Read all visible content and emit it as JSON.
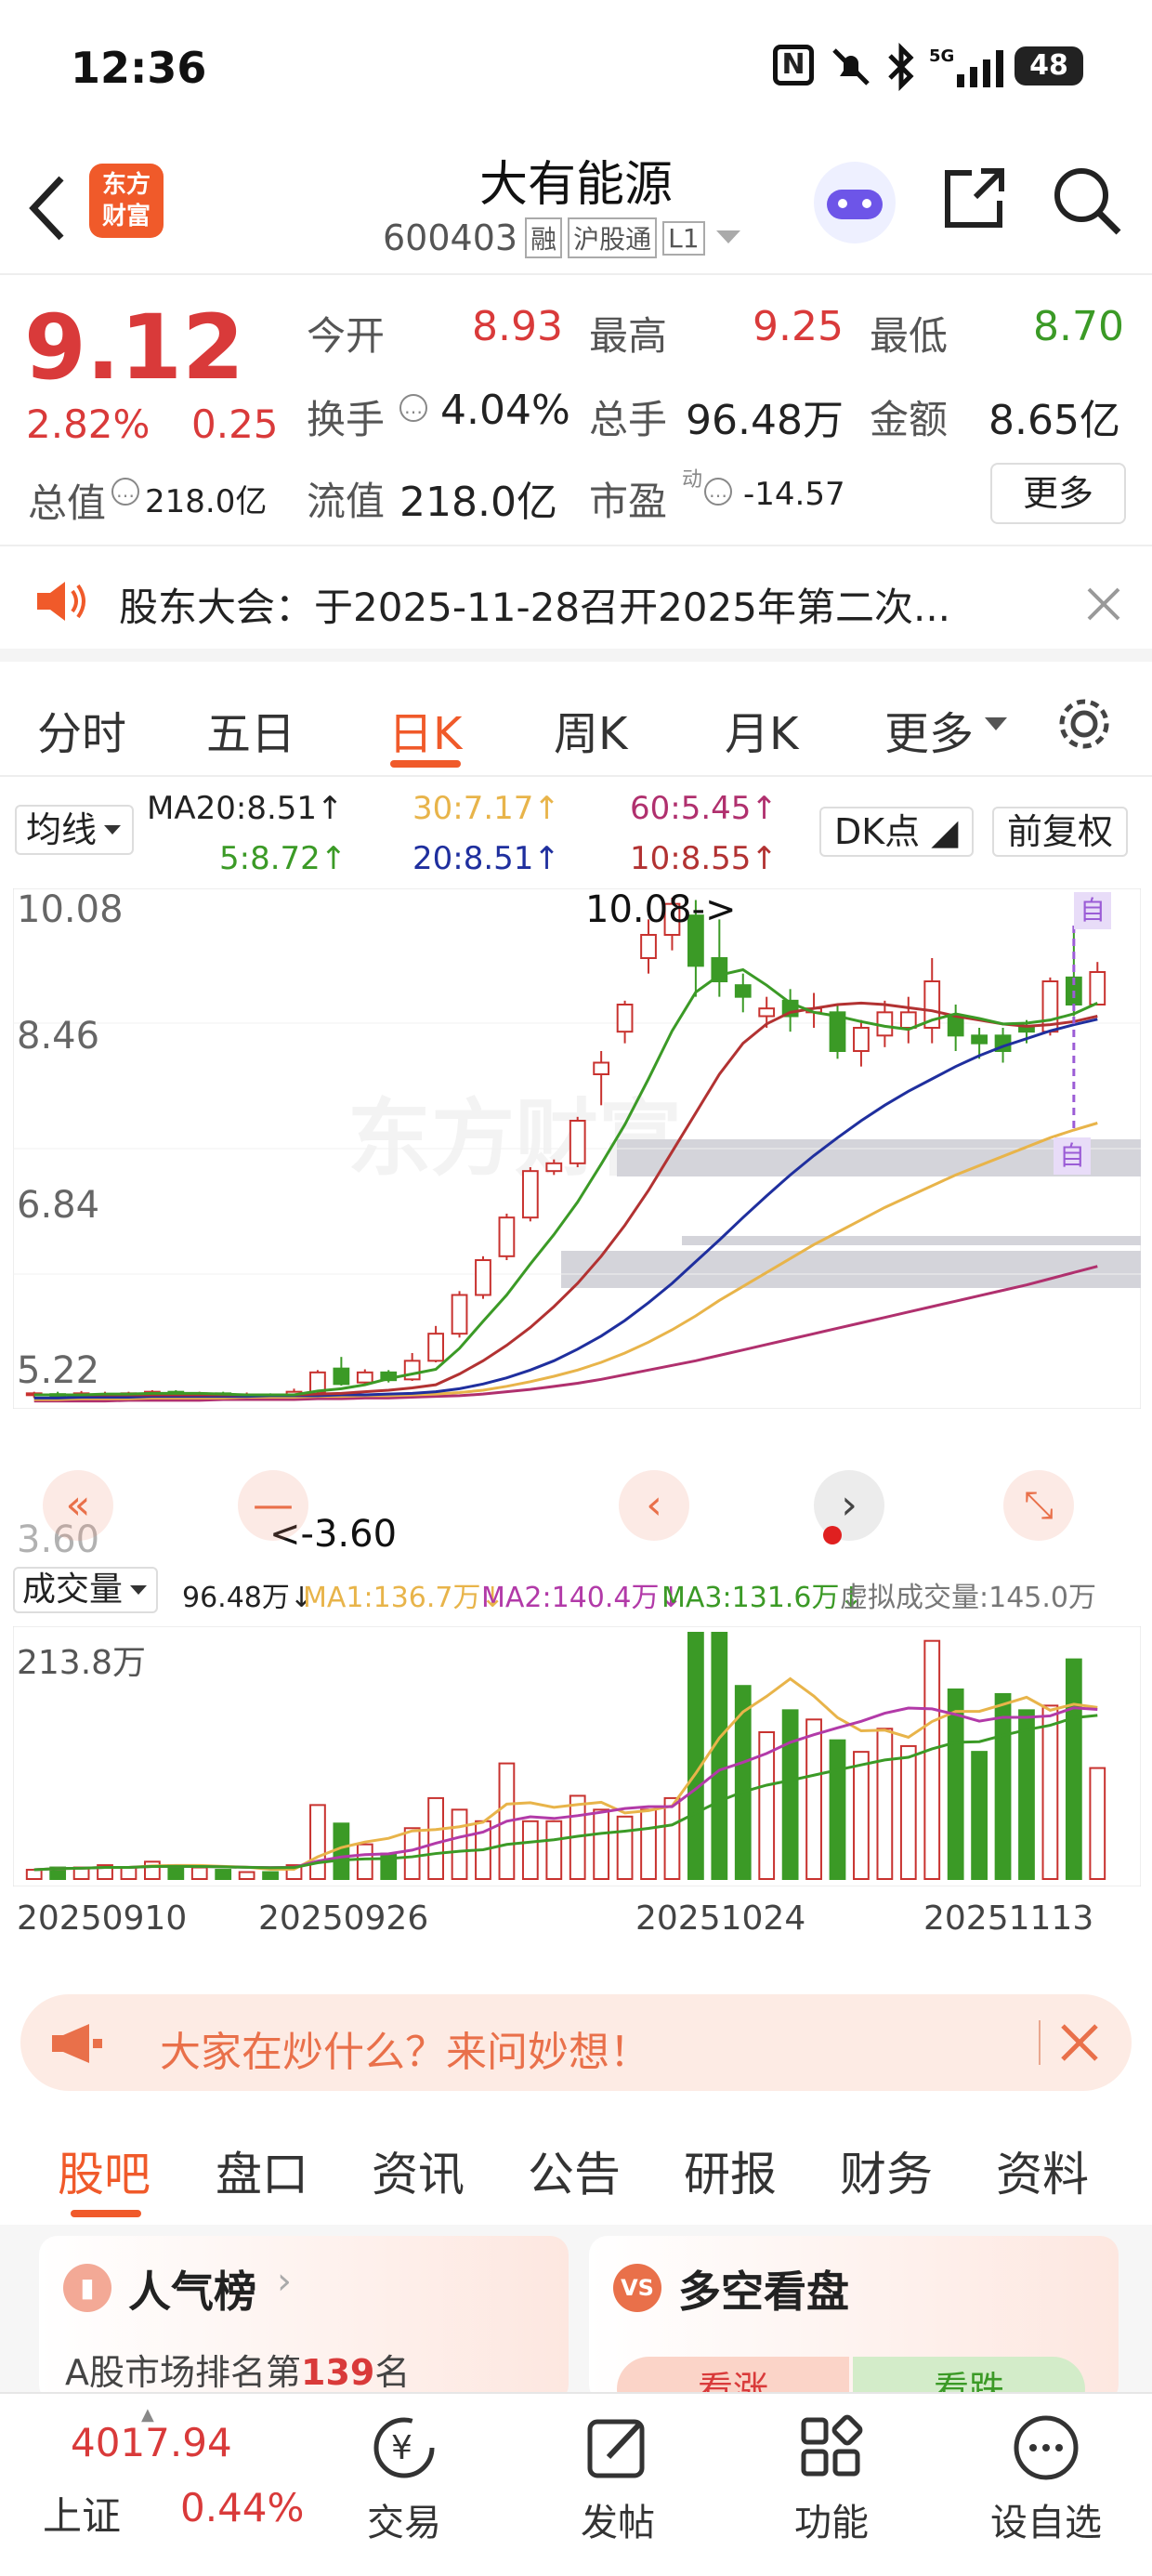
{
  "status": {
    "time": "12:36",
    "battery": "48"
  },
  "header": {
    "title": "大有能源",
    "code": "600403",
    "tags": [
      "融",
      "沪股通",
      "L1"
    ]
  },
  "quote": {
    "price": "9.12",
    "pct": "2.82%",
    "chg": "0.25",
    "open_label": "今开",
    "open": "8.93",
    "high_label": "最高",
    "high": "9.25",
    "low_label": "最低",
    "low": "8.70",
    "turn_label": "换手",
    "turn": "4.04%",
    "vol_label": "总手",
    "vol": "96.48万",
    "amt_label": "金额",
    "amt": "8.65亿",
    "mcap_label": "总值",
    "mcap": "218.0亿",
    "float_label": "流值",
    "float": "218.0亿",
    "pe_label": "市盈",
    "pe_sup": "动",
    "pe": "-14.57",
    "more": "更多"
  },
  "notice": {
    "text": "股东大会：于2025-11-28召开2025年第二次..."
  },
  "tabs": [
    "分时",
    "五日",
    "日K",
    "周K",
    "月K",
    "更多"
  ],
  "ma_legend": {
    "selector": "均线",
    "ma20a": "MA20:8.51↑",
    "ma30": "30:7.17↑",
    "ma60": "60:5.45↑",
    "ma5": "5:8.72↑",
    "ma20": "20:8.51↑",
    "ma10": "10:8.55↑",
    "dk": "DK点",
    "fq": "前复权"
  },
  "kchart": {
    "y_ticks": [
      "10.08",
      "8.46",
      "6.84",
      "5.22",
      "3.60"
    ],
    "max_label": "10.08->",
    "min_label": "<-3.60",
    "auto": "自",
    "colors": {
      "up": "#c8322f",
      "down": "#3b9a26",
      "ma5": "#3b9a26",
      "ma10": "#b23232",
      "ma20": "#1f2f9e",
      "ma30": "#e8b44a",
      "ma60": "#b0306e"
    }
  },
  "vol_legend": {
    "selector": "成交量",
    "vol": "96.48万↓",
    "ma1": "MA1:136.7万↓",
    "ma2": "MA2:140.4万↓",
    "ma3": "MA3:131.6万↓",
    "virtual": "虚拟成交量:145.0万"
  },
  "vol_chart": {
    "y_max": "213.8万",
    "x_labels": [
      "20250910",
      "20250926",
      "20251024",
      "20251113"
    ]
  },
  "chart_data": {
    "type": "candlestick",
    "ylim": [
      3.6,
      10.08
    ],
    "candles": [
      {
        "o": 3.66,
        "c": 3.68,
        "h": 3.7,
        "l": 3.62,
        "v": 8
      },
      {
        "o": 3.67,
        "c": 3.66,
        "h": 3.7,
        "l": 3.63,
        "v": 10
      },
      {
        "o": 3.66,
        "c": 3.68,
        "h": 3.71,
        "l": 3.63,
        "v": 10
      },
      {
        "o": 3.66,
        "c": 3.67,
        "h": 3.7,
        "l": 3.63,
        "v": 12
      },
      {
        "o": 3.66,
        "c": 3.68,
        "h": 3.7,
        "l": 3.63,
        "v": 10
      },
      {
        "o": 3.67,
        "c": 3.7,
        "h": 3.72,
        "l": 3.64,
        "v": 15
      },
      {
        "o": 3.7,
        "c": 3.66,
        "h": 3.72,
        "l": 3.63,
        "v": 12
      },
      {
        "o": 3.66,
        "c": 3.68,
        "h": 3.7,
        "l": 3.62,
        "v": 10
      },
      {
        "o": 3.68,
        "c": 3.64,
        "h": 3.7,
        "l": 3.6,
        "v": 8
      },
      {
        "o": 3.64,
        "c": 3.66,
        "h": 3.69,
        "l": 3.6,
        "v": 6
      },
      {
        "o": 3.66,
        "c": 3.63,
        "h": 3.68,
        "l": 3.6,
        "v": 6
      },
      {
        "o": 3.63,
        "c": 3.7,
        "h": 3.74,
        "l": 3.62,
        "v": 12
      },
      {
        "o": 3.7,
        "c": 3.95,
        "h": 3.98,
        "l": 3.68,
        "v": 64
      },
      {
        "o": 4.0,
        "c": 3.8,
        "h": 4.15,
        "l": 3.78,
        "v": 48
      },
      {
        "o": 3.82,
        "c": 3.95,
        "h": 3.99,
        "l": 3.8,
        "v": 30
      },
      {
        "o": 3.95,
        "c": 3.85,
        "h": 3.98,
        "l": 3.82,
        "v": 22
      },
      {
        "o": 3.86,
        "c": 4.1,
        "h": 4.2,
        "l": 3.84,
        "v": 44
      },
      {
        "o": 4.1,
        "c": 4.45,
        "h": 4.55,
        "l": 4.08,
        "v": 70
      },
      {
        "o": 4.45,
        "c": 4.95,
        "h": 5.0,
        "l": 4.4,
        "v": 60
      },
      {
        "o": 4.95,
        "c": 5.4,
        "h": 5.45,
        "l": 4.9,
        "v": 50
      },
      {
        "o": 5.45,
        "c": 5.95,
        "h": 6.0,
        "l": 5.4,
        "v": 100
      },
      {
        "o": 5.95,
        "c": 6.55,
        "h": 6.6,
        "l": 5.9,
        "v": 50
      },
      {
        "o": 6.55,
        "c": 6.65,
        "h": 6.7,
        "l": 6.5,
        "v": 50
      },
      {
        "o": 6.65,
        "c": 7.2,
        "h": 7.25,
        "l": 6.6,
        "v": 72
      },
      {
        "o": 7.8,
        "c": 7.95,
        "h": 8.1,
        "l": 7.4,
        "v": 60
      },
      {
        "o": 8.35,
        "c": 8.7,
        "h": 8.75,
        "l": 8.2,
        "v": 54
      },
      {
        "o": 9.3,
        "c": 9.6,
        "h": 9.8,
        "l": 9.1,
        "v": 60
      },
      {
        "o": 9.6,
        "c": 10.0,
        "h": 10.08,
        "l": 9.4,
        "v": 70
      },
      {
        "o": 9.85,
        "c": 9.2,
        "h": 10.05,
        "l": 8.8,
        "v": 213
      },
      {
        "o": 9.3,
        "c": 9.0,
        "h": 9.8,
        "l": 8.8,
        "v": 213
      },
      {
        "o": 8.95,
        "c": 8.8,
        "h": 9.1,
        "l": 8.6,
        "v": 167
      },
      {
        "o": 8.55,
        "c": 8.65,
        "h": 8.8,
        "l": 8.4,
        "v": 127
      },
      {
        "o": 8.75,
        "c": 8.55,
        "h": 8.9,
        "l": 8.35,
        "v": 146
      },
      {
        "o": 8.6,
        "c": 8.65,
        "h": 8.85,
        "l": 8.4,
        "v": 138
      },
      {
        "o": 8.6,
        "c": 8.1,
        "h": 8.7,
        "l": 8.0,
        "v": 120
      },
      {
        "o": 8.1,
        "c": 8.4,
        "h": 8.5,
        "l": 7.9,
        "v": 110
      },
      {
        "o": 8.3,
        "c": 8.6,
        "h": 8.75,
        "l": 8.15,
        "v": 130
      },
      {
        "o": 8.4,
        "c": 8.6,
        "h": 8.8,
        "l": 8.2,
        "v": 115
      },
      {
        "o": 8.4,
        "c": 9.0,
        "h": 9.3,
        "l": 8.2,
        "v": 206
      },
      {
        "o": 8.55,
        "c": 8.3,
        "h": 8.7,
        "l": 8.1,
        "v": 164
      },
      {
        "o": 8.3,
        "c": 8.2,
        "h": 8.4,
        "l": 8.0,
        "v": 110
      },
      {
        "o": 8.3,
        "c": 8.1,
        "h": 8.4,
        "l": 7.95,
        "v": 160
      },
      {
        "o": 8.4,
        "c": 8.35,
        "h": 8.5,
        "l": 8.2,
        "v": 146
      },
      {
        "o": 8.35,
        "c": 9.0,
        "h": 9.05,
        "l": 8.3,
        "v": 150
      },
      {
        "o": 9.05,
        "c": 8.7,
        "h": 9.7,
        "l": 8.55,
        "v": 190
      },
      {
        "o": 8.7,
        "c": 9.12,
        "h": 9.25,
        "l": 8.7,
        "v": 96
      }
    ],
    "ma5": [
      3.66,
      3.66,
      3.66,
      3.67,
      3.67,
      3.68,
      3.68,
      3.68,
      3.67,
      3.66,
      3.66,
      3.66,
      3.71,
      3.74,
      3.79,
      3.87,
      3.93,
      3.99,
      4.26,
      4.61,
      4.95,
      5.35,
      5.73,
      6.15,
      6.64,
      7.15,
      7.74,
      8.36,
      8.86,
      9.08,
      9.15,
      8.95,
      8.72,
      8.6,
      8.55,
      8.48,
      8.42,
      8.38,
      8.5,
      8.58,
      8.52,
      8.45,
      8.46,
      8.5,
      8.58,
      8.72
    ],
    "ma10": [
      3.66,
      3.66,
      3.66,
      3.66,
      3.66,
      3.66,
      3.66,
      3.66,
      3.66,
      3.66,
      3.66,
      3.66,
      3.67,
      3.68,
      3.7,
      3.72,
      3.75,
      3.79,
      3.93,
      4.1,
      4.3,
      4.53,
      4.8,
      5.1,
      5.45,
      5.85,
      6.3,
      6.8,
      7.3,
      7.8,
      8.2,
      8.45,
      8.6,
      8.65,
      8.7,
      8.72,
      8.7,
      8.66,
      8.62,
      8.55,
      8.5,
      8.45,
      8.42,
      8.44,
      8.48,
      8.55
    ],
    "ma20": [
      3.62,
      3.62,
      3.63,
      3.63,
      3.63,
      3.64,
      3.64,
      3.64,
      3.64,
      3.64,
      3.65,
      3.65,
      3.65,
      3.66,
      3.66,
      3.67,
      3.68,
      3.7,
      3.74,
      3.8,
      3.88,
      3.98,
      4.1,
      4.25,
      4.42,
      4.62,
      4.85,
      5.1,
      5.38,
      5.66,
      5.95,
      6.23,
      6.5,
      6.75,
      6.98,
      7.2,
      7.4,
      7.58,
      7.74,
      7.9,
      8.04,
      8.16,
      8.26,
      8.36,
      8.44,
      8.51
    ],
    "ma30": [
      3.6,
      3.6,
      3.61,
      3.61,
      3.61,
      3.62,
      3.62,
      3.62,
      3.62,
      3.63,
      3.63,
      3.63,
      3.64,
      3.64,
      3.65,
      3.65,
      3.66,
      3.67,
      3.69,
      3.72,
      3.77,
      3.83,
      3.9,
      3.98,
      4.08,
      4.2,
      4.34,
      4.5,
      4.68,
      4.88,
      5.06,
      5.24,
      5.42,
      5.6,
      5.76,
      5.92,
      6.08,
      6.22,
      6.36,
      6.5,
      6.62,
      6.74,
      6.86,
      6.98,
      7.08,
      7.17
    ],
    "ma60": [
      3.58,
      3.58,
      3.58,
      3.58,
      3.59,
      3.59,
      3.59,
      3.59,
      3.6,
      3.6,
      3.6,
      3.6,
      3.61,
      3.61,
      3.62,
      3.62,
      3.63,
      3.64,
      3.65,
      3.67,
      3.7,
      3.73,
      3.77,
      3.81,
      3.86,
      3.92,
      3.98,
      4.04,
      4.1,
      4.17,
      4.24,
      4.31,
      4.38,
      4.45,
      4.52,
      4.59,
      4.66,
      4.73,
      4.8,
      4.87,
      4.94,
      5.01,
      5.08,
      5.16,
      5.24,
      5.32
    ]
  },
  "banner": {
    "text": "大家在炒什么？来问妙想！"
  },
  "subtabs": [
    "股吧",
    "盘口",
    "资讯",
    "公告",
    "研报",
    "财务",
    "资料"
  ],
  "cards": {
    "left_title": "人气榜",
    "left_sub_prefix": "A股市场排名第",
    "left_rank": "139",
    "left_sub_suffix": "名",
    "right_title": "多空看盘",
    "bull": "看涨",
    "bear": "看跌"
  },
  "bottom": {
    "index_value": "4017.94",
    "index_name": "上证",
    "index_pct": "0.44%",
    "items": [
      "交易",
      "发帖",
      "功能",
      "设自选"
    ]
  }
}
